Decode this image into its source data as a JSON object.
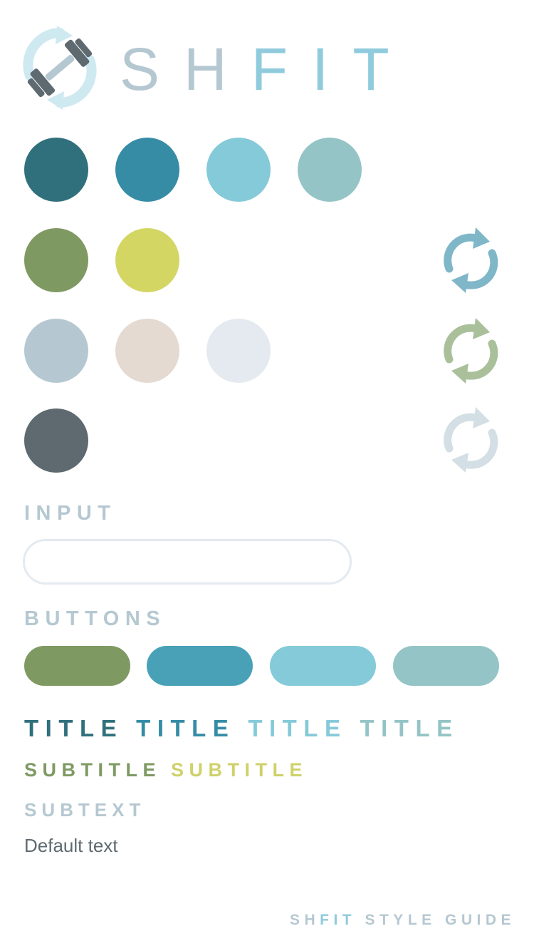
{
  "logo": {
    "word_part1": "SH",
    "word_part2": "FIT",
    "word_color1": "#b5c8d1",
    "word_color2": "#8fcbdc",
    "icon": "dumbbell-sync-icon"
  },
  "palette": [
    {
      "name": "deep-teal",
      "color": "#30707c"
    },
    {
      "name": "teal",
      "color": "#368ca5"
    },
    {
      "name": "sky",
      "color": "#85cad9"
    },
    {
      "name": "seafoam",
      "color": "#94c4c5"
    },
    {
      "name": "olive",
      "color": "#7f9963"
    },
    {
      "name": "lime",
      "color": "#d4d664"
    },
    {
      "name": "slate-light",
      "color": "#b5c8d1"
    },
    {
      "name": "sand",
      "color": "#e4dad1"
    },
    {
      "name": "mist",
      "color": "#e4eaf0"
    },
    {
      "name": "charcoal",
      "color": "#5e6a70"
    }
  ],
  "sync_icons": [
    {
      "icon": "sync-icon",
      "color": "#7fb7c8"
    },
    {
      "icon": "sync-icon",
      "color": "#a9c09a"
    },
    {
      "icon": "sync-icon",
      "color": "#d3dfe5"
    }
  ],
  "input_section": {
    "label": "INPUT",
    "value": "",
    "placeholder": ""
  },
  "buttons_section": {
    "label": "BUTTONS",
    "buttons": [
      {
        "label": "",
        "color": "#7f9963"
      },
      {
        "label": "",
        "color": "#48a1b7"
      },
      {
        "label": "",
        "color": "#85cad9"
      },
      {
        "label": "",
        "color": "#94c4c5"
      }
    ]
  },
  "typography": {
    "titles": [
      {
        "text": "TITLE",
        "color": "#30707c"
      },
      {
        "text": "TITLE",
        "color": "#368ca5"
      },
      {
        "text": "TITLE",
        "color": "#85cad9"
      },
      {
        "text": "TITLE",
        "color": "#94c4c5"
      }
    ],
    "subtitles": [
      {
        "text": "SUBTITLE",
        "color": "#7f9963"
      },
      {
        "text": "SUBTITLE",
        "color": "#cfd16a"
      }
    ],
    "subtext": "SUBTEXT",
    "default_text": "Default text"
  },
  "footer": {
    "brand_sh": "SH",
    "brand_fit": "FIT",
    "rest": " STYLE GUIDE"
  }
}
